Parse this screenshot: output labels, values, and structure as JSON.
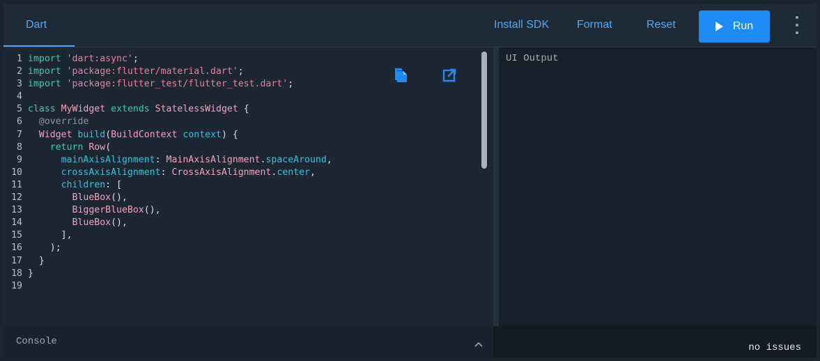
{
  "header": {
    "tab_label": "Dart",
    "install_sdk": "Install SDK",
    "format": "Format",
    "reset": "Reset",
    "run": "Run"
  },
  "editor": {
    "lines": [
      {
        "n": "1",
        "segs": [
          [
            "kw",
            "import"
          ],
          [
            "t",
            " "
          ],
          [
            "str",
            "'dart:async'"
          ],
          [
            "t",
            ";"
          ]
        ]
      },
      {
        "n": "2",
        "segs": [
          [
            "kw",
            "import"
          ],
          [
            "t",
            " "
          ],
          [
            "str",
            "'package:flutter/material.dart'"
          ],
          [
            "t",
            ";"
          ]
        ]
      },
      {
        "n": "3",
        "segs": [
          [
            "kw",
            "import"
          ],
          [
            "t",
            " "
          ],
          [
            "str",
            "'package:flutter_test/flutter_test.dart'"
          ],
          [
            "t",
            ";"
          ]
        ]
      },
      {
        "n": "4",
        "segs": []
      },
      {
        "n": "5",
        "segs": [
          [
            "kw",
            "class"
          ],
          [
            "t",
            " "
          ],
          [
            "type",
            "MyWidget"
          ],
          [
            "t",
            " "
          ],
          [
            "kw",
            "extends"
          ],
          [
            "t",
            " "
          ],
          [
            "type",
            "StatelessWidget"
          ],
          [
            "t",
            " {"
          ]
        ]
      },
      {
        "n": "6",
        "segs": [
          [
            "t",
            "  "
          ],
          [
            "ann",
            "@override"
          ]
        ]
      },
      {
        "n": "7",
        "segs": [
          [
            "t",
            "  "
          ],
          [
            "type",
            "Widget"
          ],
          [
            "t",
            " "
          ],
          [
            "prop",
            "build"
          ],
          [
            "t",
            "("
          ],
          [
            "type",
            "BuildContext"
          ],
          [
            "t",
            " "
          ],
          [
            "prop",
            "context"
          ],
          [
            "t",
            ") {"
          ]
        ]
      },
      {
        "n": "8",
        "segs": [
          [
            "t",
            "    "
          ],
          [
            "kw",
            "return"
          ],
          [
            "t",
            " "
          ],
          [
            "type",
            "Row"
          ],
          [
            "t",
            "("
          ]
        ]
      },
      {
        "n": "9",
        "segs": [
          [
            "t",
            "      "
          ],
          [
            "prop",
            "mainAxisAlignment"
          ],
          [
            "t",
            ": "
          ],
          [
            "type",
            "MainAxisAlignment"
          ],
          [
            "t",
            "."
          ],
          [
            "prop",
            "spaceAround"
          ],
          [
            "t",
            ","
          ]
        ]
      },
      {
        "n": "10",
        "segs": [
          [
            "t",
            "      "
          ],
          [
            "prop",
            "crossAxisAlignment"
          ],
          [
            "t",
            ": "
          ],
          [
            "type",
            "CrossAxisAlignment"
          ],
          [
            "t",
            "."
          ],
          [
            "prop",
            "center"
          ],
          [
            "t",
            ","
          ]
        ]
      },
      {
        "n": "11",
        "segs": [
          [
            "t",
            "      "
          ],
          [
            "prop",
            "children"
          ],
          [
            "t",
            ": ["
          ]
        ]
      },
      {
        "n": "12",
        "segs": [
          [
            "t",
            "        "
          ],
          [
            "type",
            "BlueBox"
          ],
          [
            "t",
            "(),"
          ]
        ]
      },
      {
        "n": "13",
        "segs": [
          [
            "t",
            "        "
          ],
          [
            "type",
            "BiggerBlueBox"
          ],
          [
            "t",
            "(),"
          ]
        ]
      },
      {
        "n": "14",
        "segs": [
          [
            "t",
            "        "
          ],
          [
            "type",
            "BlueBox"
          ],
          [
            "t",
            "(),"
          ]
        ]
      },
      {
        "n": "15",
        "segs": [
          [
            "t",
            "      ],"
          ]
        ]
      },
      {
        "n": "16",
        "segs": [
          [
            "t",
            "    );"
          ]
        ]
      },
      {
        "n": "17",
        "segs": [
          [
            "t",
            "  }"
          ]
        ]
      },
      {
        "n": "18",
        "segs": [
          [
            "t",
            "}"
          ]
        ]
      },
      {
        "n": "19",
        "segs": []
      }
    ]
  },
  "console": {
    "label": "Console"
  },
  "output": {
    "label": "UI Output",
    "status": "no issues"
  },
  "colors": {
    "accent": "#4aa9ff",
    "run_button": "#1e8cf5",
    "keyword": "#35d0a8",
    "string": "#f07ca0"
  },
  "icons": [
    "copy-icon",
    "open-external-icon",
    "play-icon",
    "more-vert-icon",
    "chevron-up-icon"
  ]
}
